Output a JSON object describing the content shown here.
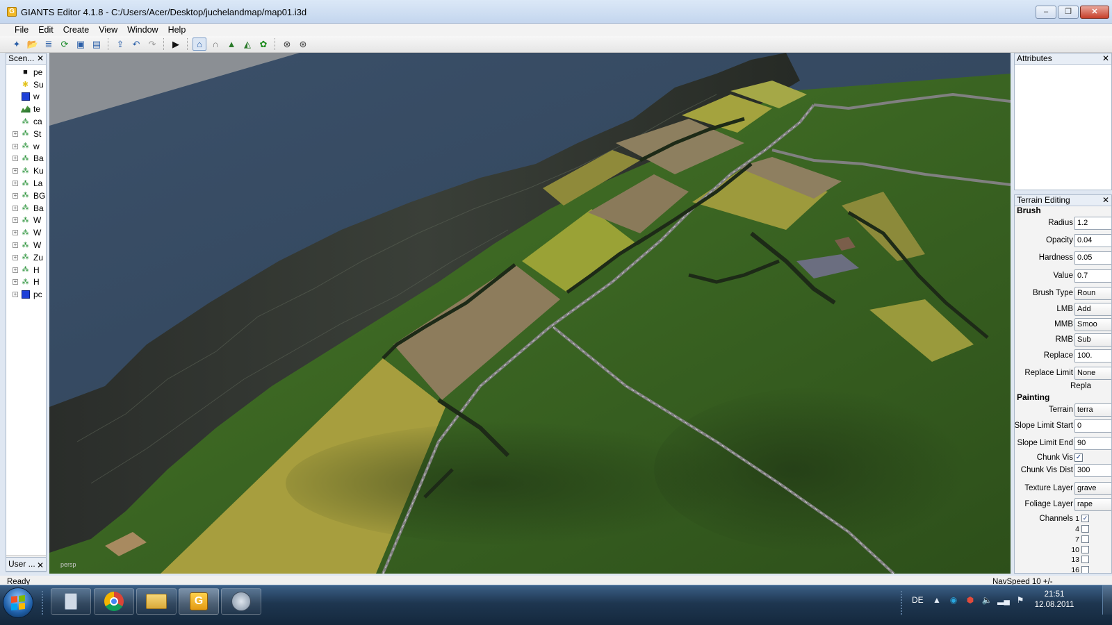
{
  "window": {
    "title": "GIANTS Editor 4.1.8 - C:/Users/Acer/Desktop/juchelandmap/map01.i3d"
  },
  "menu": [
    "File",
    "Edit",
    "Create",
    "View",
    "Window",
    "Help"
  ],
  "scenegraph": {
    "title": "Scen...",
    "items": [
      {
        "label": "pe",
        "icon": "camera-icon",
        "expandable": false
      },
      {
        "label": "Su",
        "icon": "light-icon",
        "expandable": false
      },
      {
        "label": "w",
        "icon": "cube-icon",
        "expandable": false
      },
      {
        "label": "te",
        "icon": "terrain-icon",
        "expandable": false
      },
      {
        "label": "ca",
        "icon": "transform-group-icon",
        "expandable": false
      },
      {
        "label": "St",
        "icon": "transform-group-icon",
        "expandable": true
      },
      {
        "label": "w",
        "icon": "transform-group-icon",
        "expandable": true
      },
      {
        "label": "Ba",
        "icon": "transform-group-icon",
        "expandable": true
      },
      {
        "label": "Ku",
        "icon": "transform-group-icon",
        "expandable": true
      },
      {
        "label": "La",
        "icon": "transform-group-icon",
        "expandable": true
      },
      {
        "label": "BG",
        "icon": "transform-group-icon",
        "expandable": true
      },
      {
        "label": "Ba",
        "icon": "transform-group-icon",
        "expandable": true
      },
      {
        "label": "W",
        "icon": "transform-group-icon",
        "expandable": true
      },
      {
        "label": "W",
        "icon": "transform-group-icon",
        "expandable": true
      },
      {
        "label": "W",
        "icon": "transform-group-icon",
        "expandable": true
      },
      {
        "label": "Zu",
        "icon": "transform-group-icon",
        "expandable": true
      },
      {
        "label": "H",
        "icon": "transform-group-icon",
        "expandable": true
      },
      {
        "label": "H",
        "icon": "transform-group-icon",
        "expandable": true
      },
      {
        "label": "pc",
        "icon": "cube-icon",
        "expandable": true
      }
    ]
  },
  "user_panel": {
    "title": "User ..."
  },
  "viewport": {
    "camera_label": "persp"
  },
  "attributes": {
    "title": "Attributes"
  },
  "terrain_editing": {
    "title": "Terrain Editing",
    "brush_section": "Brush",
    "radius_label": "Radius",
    "radius": "1.2",
    "opacity_label": "Opacity",
    "opacity": "0.04",
    "hardness_label": "Hardness",
    "hardness": "0.05",
    "value_label": "Value",
    "value": "0.7",
    "brush_type_label": "Brush Type",
    "brush_type": "Roun",
    "lmb_label": "LMB",
    "lmb": "Add",
    "mmb_label": "MMB",
    "mmb": "Smoo",
    "rmb_label": "RMB",
    "rmb": "Sub",
    "replace_label": "Replace",
    "replace": "100.",
    "replace_limit_label": "Replace Limit",
    "replace_limit": "None",
    "repla_text": "Repla",
    "painting_section": "Painting",
    "terrain_label": "Terrain",
    "terrain": "terra",
    "slope_start_label": "Slope Limit Start",
    "slope_start": "0",
    "slope_end_label": "Slope Limit End",
    "slope_end": "90",
    "chunk_vis_label": "Chunk Vis",
    "chunk_vis": "✓",
    "chunk_vis_dist_label": "Chunk Vis Dist",
    "chunk_vis_dist": "300",
    "texture_layer_label": "Texture Layer",
    "texture_layer": "grave",
    "foliage_layer_label": "Foliage Layer",
    "foliage_layer": "rape",
    "channels_label": "Channels",
    "channels": [
      {
        "num": "1",
        "checked": "✓"
      },
      {
        "num": "4",
        "checked": ""
      },
      {
        "num": "7",
        "checked": ""
      },
      {
        "num": "10",
        "checked": ""
      },
      {
        "num": "13",
        "checked": ""
      },
      {
        "num": "16",
        "checked": ""
      }
    ]
  },
  "status": {
    "left": "Ready",
    "right": "NavSpeed 10 +/-"
  },
  "taskbar": {
    "language": "DE",
    "time": "21:51",
    "date": "12.08.2011"
  },
  "colors": {
    "water": "#3a4f67",
    "grass": "#3f6a1f",
    "field_yellow": "#a39a3c",
    "field_brown": "#8b7a5a",
    "mountain": "#2b2e2a"
  }
}
